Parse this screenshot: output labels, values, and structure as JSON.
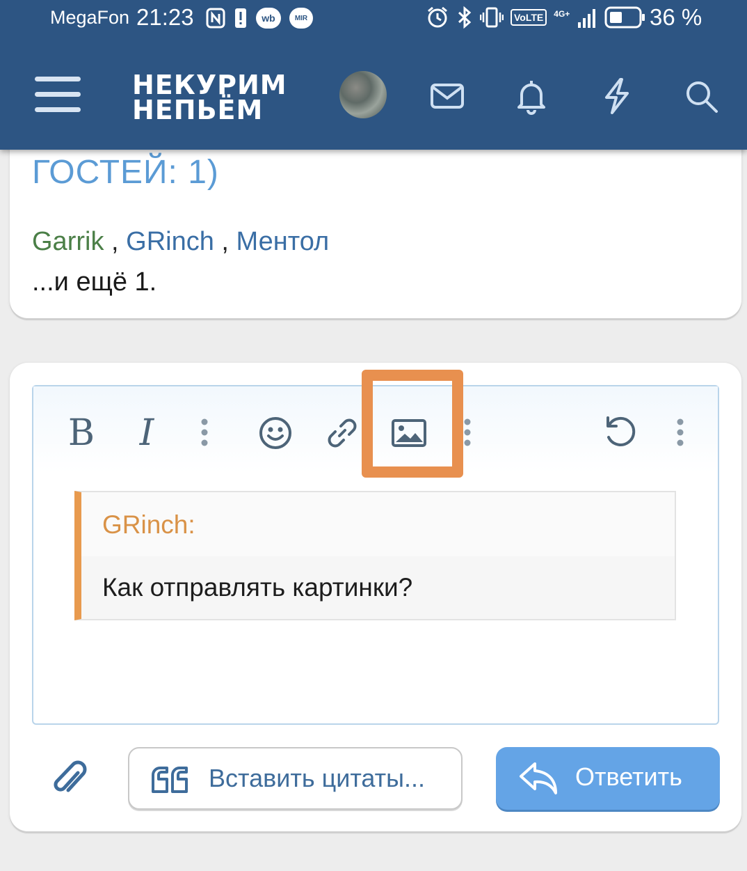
{
  "status_bar": {
    "carrier": "MegaFon",
    "time": "21:23",
    "badge_wb": "wb",
    "badge_mir": "MIR",
    "volte": "VoLTE",
    "network": "4G+",
    "battery_percent": "36 %"
  },
  "header": {
    "logo_line1": "НЕКУРИМ",
    "logo_line2": "НЕПЬЁМ",
    "icons": [
      "menu-icon",
      "avatar",
      "envelope-icon",
      "bell-icon",
      "lightning-icon",
      "search-icon"
    ]
  },
  "online": {
    "title": "ГОСТЕЙ: 1)",
    "users": [
      "Garrik",
      "GRinch",
      "Ментол"
    ],
    "separator": " , ",
    "more": "...и ещё 1."
  },
  "editor": {
    "toolbar": {
      "bold": "B",
      "italic": "I",
      "items": [
        "bold-icon",
        "italic-icon",
        "more-vertical-icon",
        "smiley-icon",
        "link-icon",
        "image-icon",
        "more-vertical-icon",
        "undo-icon",
        "more-vertical-icon"
      ]
    },
    "quote": {
      "author": "GRinch:",
      "text": "Как отправлять картинки?"
    }
  },
  "actions": {
    "insert_quotes": "Вставить цитаты...",
    "reply": "Ответить"
  },
  "colors": {
    "header_bg": "#2d5583",
    "accent_blue": "#64a4e6",
    "highlight_orange": "#e8904f",
    "quote_border": "#e89a4e",
    "link_blue": "#3a6ea5",
    "user_green": "#4b7f47"
  }
}
